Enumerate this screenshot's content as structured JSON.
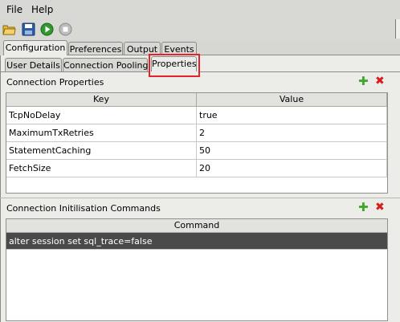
{
  "menu": {
    "file": "File",
    "help": "Help"
  },
  "toolbar": {
    "icons": [
      "open-folder-icon",
      "save-icon",
      "run-icon",
      "stop-icon"
    ]
  },
  "tabs": {
    "main": [
      "Configuration",
      "Preferences",
      "Output",
      "Events"
    ],
    "sub": [
      "User Details",
      "Connection Pooling",
      "Properties"
    ]
  },
  "connection_properties": {
    "title": "Connection Properties",
    "columns": [
      "Key",
      "Value"
    ],
    "rows": [
      {
        "key": "TcpNoDelay",
        "value": "true"
      },
      {
        "key": "MaximumTxRetries",
        "value": "2"
      },
      {
        "key": "StatementCaching",
        "value": "50"
      },
      {
        "key": "FetchSize",
        "value": "20"
      }
    ]
  },
  "init_commands": {
    "title": "Connection Initilisation Commands",
    "column": "Command",
    "rows": [
      "alter session set sql_trace=false"
    ]
  },
  "colors": {
    "highlight": "#e8202a",
    "selection": "#4a4a4a",
    "add": "#3fa82a",
    "remove": "#d81b1b"
  }
}
